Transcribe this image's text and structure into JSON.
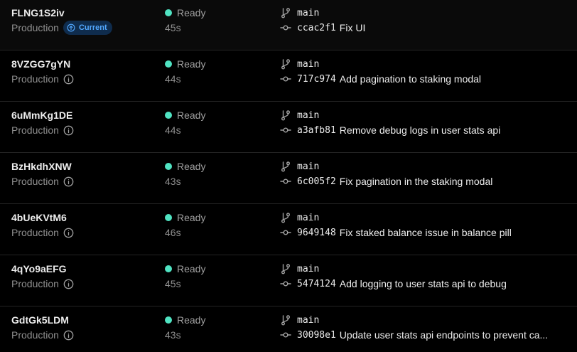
{
  "deployments": [
    {
      "id": "FLNG1S2iv",
      "environment": "Production",
      "current_badge": "Current",
      "status": "Ready",
      "duration": "45s",
      "branch": "main",
      "commit_sha": "ccac2f1",
      "commit_message": "Fix UI"
    },
    {
      "id": "8VZGG7gYN",
      "environment": "Production",
      "status": "Ready",
      "duration": "44s",
      "branch": "main",
      "commit_sha": "717c974",
      "commit_message": "Add pagination to staking modal"
    },
    {
      "id": "6uMmKg1DE",
      "environment": "Production",
      "status": "Ready",
      "duration": "44s",
      "branch": "main",
      "commit_sha": "a3afb81",
      "commit_message": "Remove debug logs in user stats api"
    },
    {
      "id": "BzHkdhXNW",
      "environment": "Production",
      "status": "Ready",
      "duration": "43s",
      "branch": "main",
      "commit_sha": "6c005f2",
      "commit_message": "Fix pagination in the staking modal"
    },
    {
      "id": "4bUeKVtM6",
      "environment": "Production",
      "status": "Ready",
      "duration": "46s",
      "branch": "main",
      "commit_sha": "9649148",
      "commit_message": "Fix staked balance issue in balance pill"
    },
    {
      "id": "4qYo9aEFG",
      "environment": "Production",
      "status": "Ready",
      "duration": "45s",
      "branch": "main",
      "commit_sha": "5474124",
      "commit_message": "Add logging to user stats api to debug"
    },
    {
      "id": "GdtGk5LDM",
      "environment": "Production",
      "status": "Ready",
      "duration": "43s",
      "branch": "main",
      "commit_sha": "30098e1",
      "commit_message": "Update user stats api endpoints to prevent ca..."
    }
  ],
  "colors": {
    "background": "#000000",
    "ready_dot": "#50e3c2",
    "badge_bg": "#0f2c4d",
    "badge_text": "#52a8ff"
  },
  "icons": {
    "environment_info": "info-circle-icon",
    "current_badge": "arrow-up-circle-icon",
    "branch": "git-branch-icon",
    "commit": "git-commit-icon"
  }
}
